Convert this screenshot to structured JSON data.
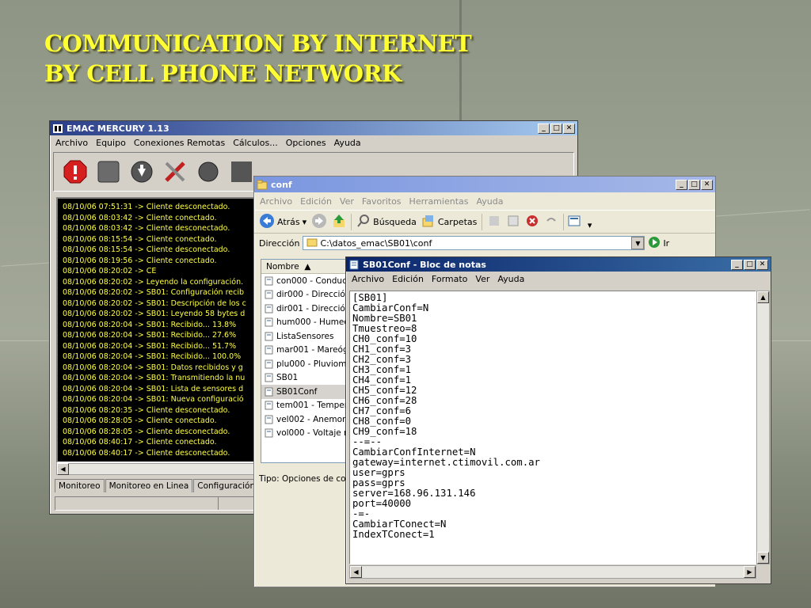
{
  "slide": {
    "title_line1": "COMMUNICATION BY INTERNET",
    "title_line2": "BY CELL PHONE NETWORK"
  },
  "emac": {
    "title": "EMAC MERCURY 1.13",
    "menu": [
      "Archivo",
      "Equipo",
      "Conexiones Remotas",
      "Cálculos...",
      "Opciones",
      "Ayuda"
    ],
    "log": [
      "08/10/06 07:51:31  -> Cliente desconectado.",
      "08/10/06 08:03:42  -> Cliente conectado.",
      "08/10/06 08:03:42  -> Cliente desconectado.",
      "08/10/06 08:15:54  -> Cliente conectado.",
      "08/10/06 08:15:54  -> Cliente desconectado.",
      "08/10/06 08:19:56  -> Cliente conectado.",
      "08/10/06 08:20:02  -> CE",
      "08/10/06 08:20:02  -> Leyendo la configuración.",
      "08/10/06 08:20:02  -> SB01: Configuración recib",
      "08/10/06 08:20:02  -> SB01: Descripción de los c",
      "08/10/06 08:20:02  -> SB01: Leyendo 58 bytes d",
      "08/10/06 08:20:04  -> SB01: Recibido... 13.8%",
      "08/10/06 08:20:04  -> SB01: Recibido... 27.6%",
      "08/10/06 08:20:04  -> SB01: Recibido... 51.7%",
      "08/10/06 08:20:04  -> SB01: Recibido... 100.0%",
      "08/10/06 08:20:04  -> SB01: Datos recibidos y g",
      "08/10/06 08:20:04  -> SB01: Transmitiendo la nu",
      "08/10/06 08:20:04  -> SB01: Lista de sensores d",
      "08/10/06 08:20:04  -> SB01: Nueva configuració",
      "08/10/06 08:20:35  -> Cliente desconectado.",
      "08/10/06 08:28:05  -> Cliente conectado.",
      "08/10/06 08:28:05  -> Cliente desconectado.",
      "08/10/06 08:40:17  -> Cliente conectado.",
      "08/10/06 08:40:17  -> Cliente desconectado."
    ],
    "tabs": [
      "Monitoreo",
      "Monitoreo en Linea",
      "Configuración d"
    ]
  },
  "explorer": {
    "title": "conf",
    "menu": [
      "Archivo",
      "Edición",
      "Ver",
      "Favoritos",
      "Herramientas",
      "Ayuda"
    ],
    "back_label": "Atrás",
    "search_label": "Búsqueda",
    "folders_label": "Carpetas",
    "address_label": "Dirección",
    "address_value": "C:\\datos_emac\\SB01\\conf",
    "go_label": "Ir",
    "column_header": "Nombre",
    "files": [
      "con000 - Conduct",
      "dir000 - Dirección",
      "dir001 - Dirección",
      "hum000 - Humed",
      "ListaSensores",
      "mar001 - Mareóg",
      "plu000 - Pluviome",
      "SB01",
      "SB01Conf",
      "tem001 - Temper",
      "vel002 - Anemom",
      "vol000 - Voltaje n"
    ],
    "status": "Tipo: Opciones de cor"
  },
  "notepad": {
    "title": "SB01Conf - Bloc de notas",
    "menu": [
      "Archivo",
      "Edición",
      "Formato",
      "Ver",
      "Ayuda"
    ],
    "lines": [
      "[SB01]",
      "CambiarConf=N",
      "Nombre=SB01",
      "Tmuestreo=8",
      "CH0_conf=10",
      "CH1_conf=3",
      "CH2_conf=3",
      "CH3_conf=1",
      "CH4_conf=1",
      "CH5_conf=12",
      "CH6_conf=28",
      "CH7_conf=6",
      "CH8_conf=0",
      "CH9_conf=18",
      "--=--",
      "CambiarConfInternet=N",
      "gateway=internet.ctimovil.com.ar",
      "user=gprs",
      "pass=gprs",
      "server=168.96.131.146",
      "port=40000",
      "-=-",
      "CambiarTConect=N",
      "IndexTConect=1"
    ]
  }
}
